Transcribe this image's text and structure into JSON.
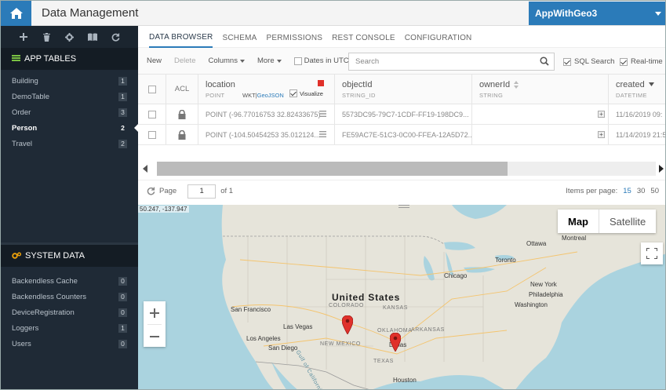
{
  "header": {
    "title": "Data Management",
    "app_name": "AppWithGeo3"
  },
  "sidebar": {
    "app_tables_label": "APP TABLES",
    "tables": [
      {
        "label": "Building",
        "count": "1"
      },
      {
        "label": "DemoTable",
        "count": "1"
      },
      {
        "label": "Order",
        "count": "3"
      },
      {
        "label": "Person",
        "count": "2"
      },
      {
        "label": "Travel",
        "count": "2"
      }
    ],
    "system_data_label": "SYSTEM DATA",
    "system": [
      {
        "label": "Backendless Cache",
        "count": "0"
      },
      {
        "label": "Backendless Counters",
        "count": "0"
      },
      {
        "label": "DeviceRegistration",
        "count": "0"
      },
      {
        "label": "Loggers",
        "count": "1"
      },
      {
        "label": "Users",
        "count": "0"
      }
    ]
  },
  "tabs": [
    "DATA BROWSER",
    "SCHEMA",
    "PERMISSIONS",
    "REST CONSOLE",
    "CONFIGURATION"
  ],
  "toolbar": {
    "new": "New",
    "delete": "Delete",
    "columns": "Columns",
    "more": "More",
    "dates_utc": "Dates in UTC",
    "search_placeholder": "Search",
    "sql_search": "SQL Search",
    "realtime": "Real-time"
  },
  "grid": {
    "acl_header": "ACL",
    "columns": [
      {
        "name": "location",
        "type": "POINT"
      },
      {
        "name": "objectId",
        "type": "STRING_ID"
      },
      {
        "name": "ownerId",
        "type": "STRING"
      },
      {
        "name": "created",
        "type": "DATETIME"
      }
    ],
    "wkt": "WKT",
    "sep": "|",
    "geojson": "GeoJSON",
    "visualize": "Visualize",
    "rows": [
      {
        "location": "POINT (-96.77016753 32.82433675)",
        "objectId": "5573DC95-79C7-1CDF-FF19-198DC9...",
        "ownerId": "",
        "created": "11/16/2019 09:"
      },
      {
        "location": "POINT (-104.50454253 35.012124...",
        "objectId": "FE59AC7E-51C3-0C00-FFEA-12A5D72...",
        "ownerId": "",
        "created": "11/14/2019 21:5"
      }
    ]
  },
  "pager": {
    "page_label": "Page",
    "page_value": "1",
    "of_label": "of 1",
    "ipp_label": "Items per page:",
    "ipp_options": [
      "15",
      "30",
      "50"
    ],
    "ipp_selected": "15"
  },
  "map": {
    "coord_readout": "50.247, -137.947",
    "map_btn": "Map",
    "satellite_btn": "Satellite",
    "country": "United States",
    "cities": [
      "Ottawa",
      "Montreal",
      "Toronto",
      "Chicago",
      "New York",
      "Philadelphia",
      "Washington",
      "San Francisco",
      "Las Vegas",
      "Los Angeles",
      "San Diego",
      "Dallas",
      "Houston"
    ],
    "states": [
      "COLORADO",
      "OKLAHOMA",
      "TEXAS",
      "NEW MEXICO",
      "KANSAS",
      "ARKANSAS"
    ],
    "water": "Gulf of California",
    "colors": {
      "land": "#e6e4da",
      "water": "#aad3df",
      "marker": "#e0302a",
      "accent": "#2b7bb9"
    }
  }
}
